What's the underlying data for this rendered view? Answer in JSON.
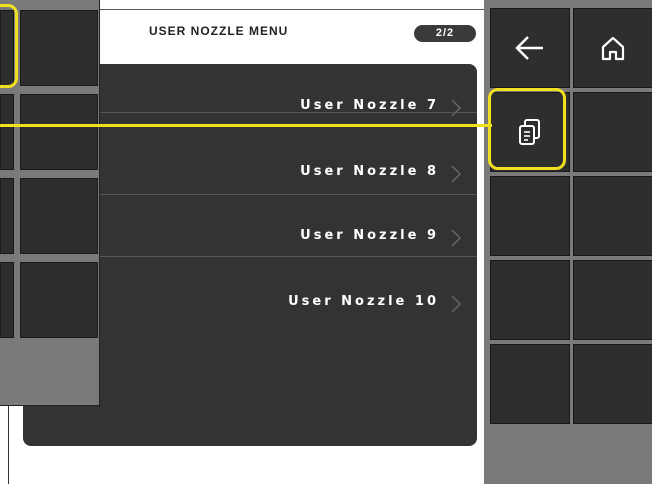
{
  "menu": {
    "title": "USER NOZZLE MENU",
    "page_indicator": "2/2",
    "items": [
      {
        "label": "User Nozzle 7"
      },
      {
        "label": "User Nozzle 8"
      },
      {
        "label": "User Nozzle 9"
      },
      {
        "label": "User Nozzle 10"
      }
    ]
  },
  "sidebar": {
    "back_icon": "arrow-left-icon",
    "home_icon": "home-icon",
    "copy_icon": "copy-document-icon"
  },
  "colors": {
    "highlight": "#f0e020",
    "panel": "#333333",
    "sidebar": "#7a7a7a"
  }
}
